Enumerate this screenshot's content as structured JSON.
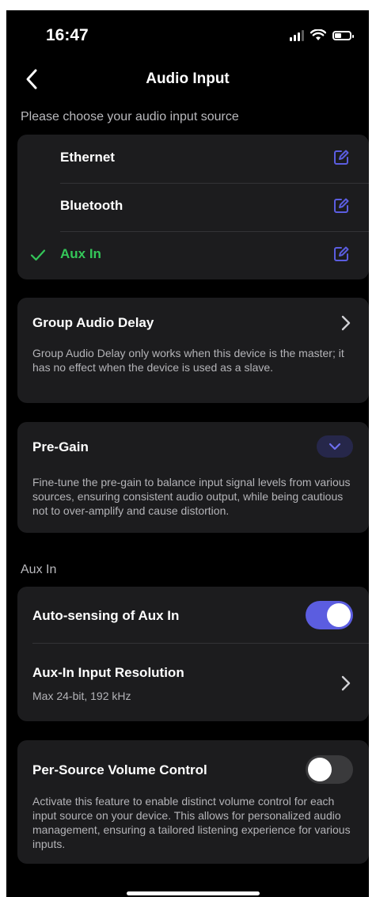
{
  "status": {
    "time": "16:47"
  },
  "nav": {
    "title": "Audio Input"
  },
  "sources": {
    "heading": "Please choose your audio input source",
    "items": [
      {
        "label": "Ethernet",
        "selected": false
      },
      {
        "label": "Bluetooth",
        "selected": false
      },
      {
        "label": "Aux In",
        "selected": true
      }
    ]
  },
  "group_delay": {
    "title": "Group Audio Delay",
    "description": "Group Audio Delay only works when this device is the master; it has no effect when the device is used as a slave."
  },
  "pre_gain": {
    "title": "Pre-Gain",
    "description": "Fine-tune the pre-gain to balance input signal levels from various sources, ensuring consistent audio output, while being cautious not to over-amplify and cause distortion."
  },
  "aux_in": {
    "heading": "Aux In",
    "auto_sensing": {
      "label": "Auto-sensing of Aux In",
      "enabled": true
    },
    "resolution": {
      "label": "Aux-In Input Resolution",
      "value": "Max 24-bit, 192 kHz"
    }
  },
  "volume_control": {
    "title": "Per-Source Volume Control",
    "enabled": false,
    "description": "Activate this feature to enable distinct volume control for each input source on your device. This allows for personalized audio management, ensuring a tailored listening experience for various inputs."
  },
  "colors": {
    "accent": "#5b5de0",
    "selected": "#34c759",
    "edit_icon": "#5b5de0",
    "card": "#1c1c1e"
  },
  "icons": [
    "back-arrow-icon",
    "edit-icon",
    "checkmark-icon",
    "chevron-right-icon",
    "chevron-down-icon"
  ]
}
